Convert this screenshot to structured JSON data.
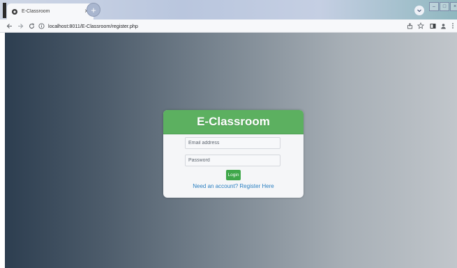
{
  "browser": {
    "tab_title": "E-Classroom",
    "tab_close": "×",
    "new_tab": "+",
    "url": "localhost:8011/E-Classroom/register.php"
  },
  "page": {
    "brand": "E-Classroom",
    "email_placeholder": "Email address",
    "password_placeholder": "Password",
    "login_label": "Login",
    "register_link": "Need an account? Register Here"
  },
  "colors": {
    "header_green": "#5cb060",
    "button_green": "#3fa74a",
    "link_blue": "#2a7fc1",
    "bg_dark": "#2d3e50",
    "bg_light": "#c1c6cb"
  }
}
